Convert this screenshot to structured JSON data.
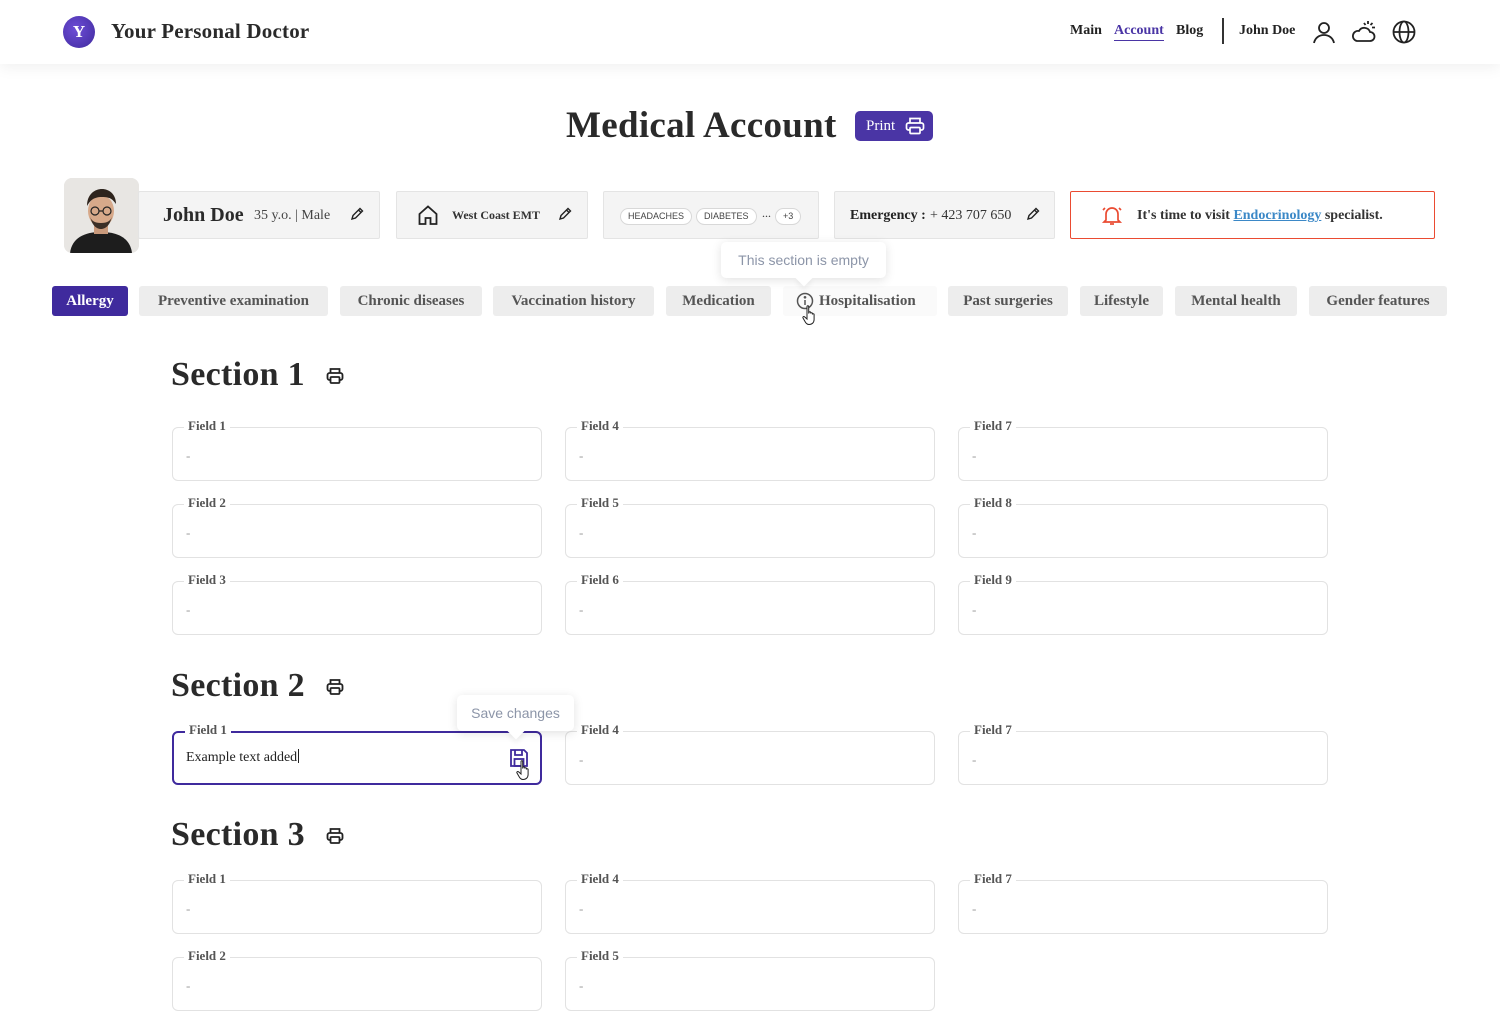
{
  "header": {
    "brand": "Your Personal Doctor",
    "logo_letter": "Y",
    "nav": {
      "main": "Main",
      "account": "Account",
      "blog": "Blog"
    },
    "user_name": "John Doe",
    "icons": [
      "user-icon",
      "weather-icon",
      "globe-icon"
    ]
  },
  "page": {
    "title": "Medical Account",
    "print_label": "Print"
  },
  "profile": {
    "name": "John Doe",
    "meta": "35 y.o. | Male",
    "emt": "West Coast EMT",
    "tags": [
      "HEADACHES",
      "DIABETES"
    ],
    "tags_ellipsis": "...",
    "tags_more": "+3",
    "emergency_label": "Emergency :",
    "emergency_value": "+ 423 707 650"
  },
  "alert": {
    "prefix": "It's time to visit ",
    "link": "Endocrinology",
    "suffix": " specialist."
  },
  "tooltips": {
    "empty_section": "This section is empty",
    "save_changes": "Save changes"
  },
  "tabs": [
    {
      "label": "Allergy",
      "active": true
    },
    {
      "label": "Preventive examination"
    },
    {
      "label": "Chronic diseases"
    },
    {
      "label": "Vaccination history"
    },
    {
      "label": "Medication"
    },
    {
      "label": "Hospitalisation",
      "empty": true
    },
    {
      "label": "Past surgeries"
    },
    {
      "label": "Lifestyle"
    },
    {
      "label": "Mental health"
    },
    {
      "label": "Gender features"
    }
  ],
  "sections": [
    {
      "title": "Section 1",
      "fields": [
        {
          "label": "Field 1",
          "value": "-"
        },
        {
          "label": "Field 2",
          "value": "-"
        },
        {
          "label": "Field 3",
          "value": "-"
        },
        {
          "label": "Field 4",
          "value": "-"
        },
        {
          "label": "Field 5",
          "value": "-"
        },
        {
          "label": "Field 6",
          "value": "-"
        },
        {
          "label": "Field 7",
          "value": "-"
        },
        {
          "label": "Field 8",
          "value": "-"
        },
        {
          "label": "Field 9",
          "value": "-"
        }
      ]
    },
    {
      "title": "Section 2",
      "fields": [
        {
          "label": "Field 1",
          "value": "Example text added"
        },
        {
          "label": "Field 4",
          "value": "-"
        },
        {
          "label": "Field 7",
          "value": "-"
        }
      ]
    },
    {
      "title": "Section 3",
      "fields": [
        {
          "label": "Field 1",
          "value": "-"
        },
        {
          "label": "Field 2",
          "value": "-"
        },
        {
          "label": "Field 4",
          "value": "-"
        },
        {
          "label": "Field 5",
          "value": "-"
        },
        {
          "label": "Field 7",
          "value": "-"
        }
      ]
    }
  ],
  "colors": {
    "primary": "#3f2a9d",
    "alert_border": "#ea4b32",
    "link": "#3b88c7"
  }
}
